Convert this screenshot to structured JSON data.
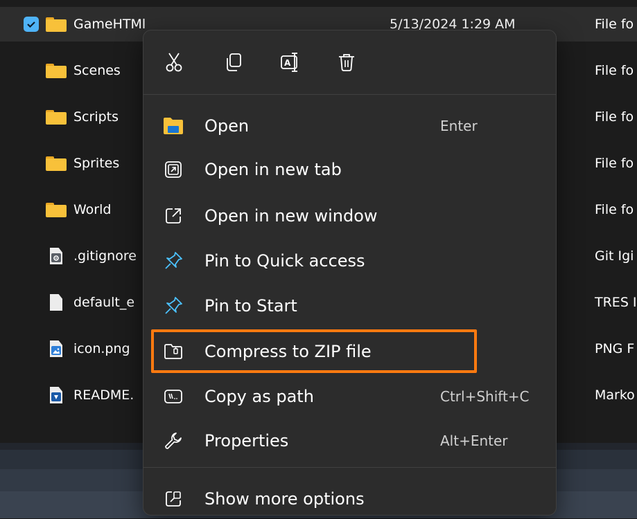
{
  "file_list": {
    "rows": [
      {
        "name": "GameHTMl",
        "date": "5/13/2024 1:29 AM",
        "type": "File fo",
        "icon": "folder-icon",
        "selected": true
      },
      {
        "name": "Scenes",
        "type": "File fo",
        "icon": "folder-icon"
      },
      {
        "name": "Scripts",
        "type": "File fo",
        "icon": "folder-icon"
      },
      {
        "name": "Sprites",
        "type": "File fo",
        "icon": "folder-icon"
      },
      {
        "name": "World",
        "type": "File fo",
        "icon": "folder-icon"
      },
      {
        "name": ".gitignore",
        "type": "Git Igi",
        "icon": "settings-file-icon"
      },
      {
        "name": "default_e",
        "type": "TRES I",
        "icon": "blank-file-icon"
      },
      {
        "name": "icon.png",
        "type": "PNG F",
        "icon": "image-file-icon"
      },
      {
        "name": "README.",
        "type": "Marko",
        "icon": "markdown-file-icon"
      }
    ]
  },
  "context_menu": {
    "quick_actions": [
      {
        "name": "cut",
        "icon": "scissors-icon"
      },
      {
        "name": "copy",
        "icon": "copy-icon"
      },
      {
        "name": "rename",
        "icon": "rename-icon"
      },
      {
        "name": "delete",
        "icon": "trash-icon"
      }
    ],
    "items": [
      {
        "label": "Open",
        "shortcut": "Enter",
        "icon": "folder-open-icon"
      },
      {
        "label": "Open in new tab",
        "shortcut": "",
        "icon": "new-tab-icon"
      },
      {
        "label": "Open in new window",
        "shortcut": "",
        "icon": "new-window-icon"
      },
      {
        "label": "Pin to Quick access",
        "shortcut": "",
        "icon": "pin-icon"
      },
      {
        "label": "Pin to Start",
        "shortcut": "",
        "icon": "pin-icon"
      },
      {
        "label": "Compress to ZIP file",
        "shortcut": "",
        "icon": "zip-folder-icon",
        "highlighted": true
      },
      {
        "label": "Copy as path",
        "shortcut": "Ctrl+Shift+C",
        "icon": "copy-path-icon"
      },
      {
        "label": "Properties",
        "shortcut": "Alt+Enter",
        "icon": "wrench-icon"
      }
    ],
    "more_options": {
      "label": "Show more options",
      "icon": "show-more-icon"
    }
  },
  "colors": {
    "highlight_border": "#ff7a10",
    "checkbox": "#4fb3f7",
    "folder": "#f8c13a",
    "menu_bg": "#2c2c2c",
    "accent_blue": "#4cc2ff"
  }
}
